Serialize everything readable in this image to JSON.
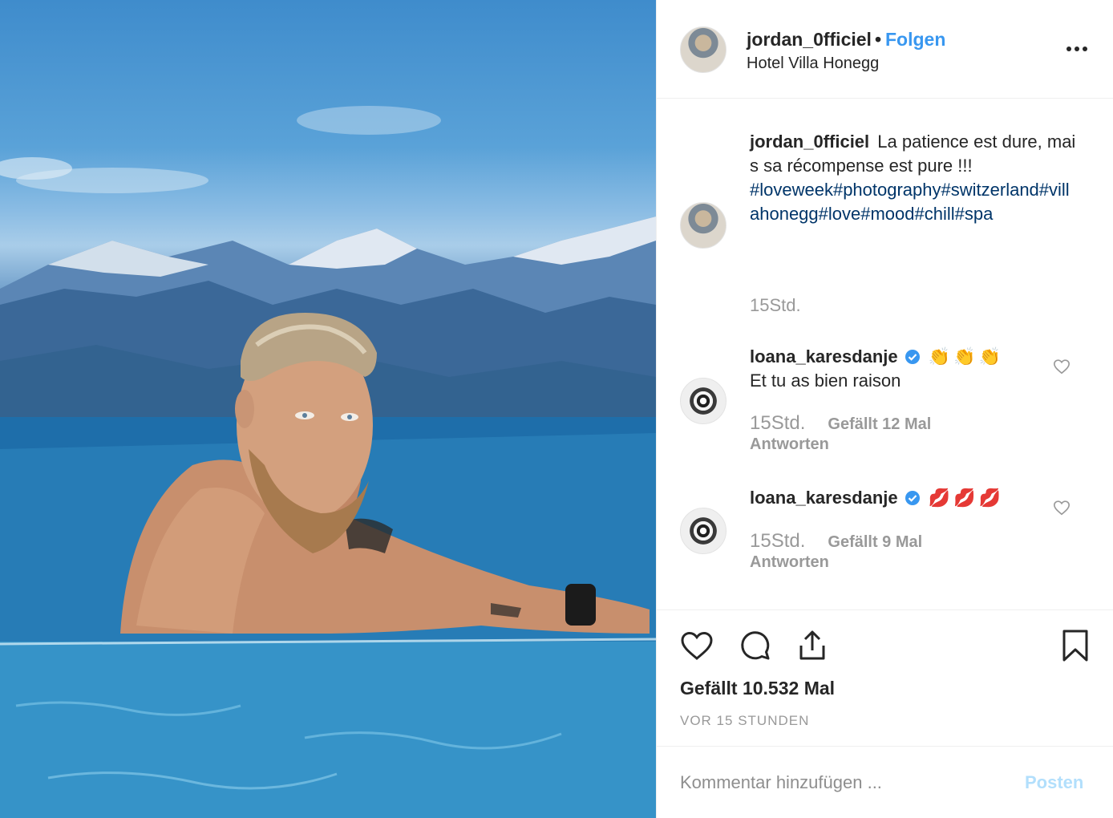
{
  "post": {
    "image": {
      "description_icon": "photo-image"
    },
    "owner": {
      "username": "jordan_0fficiel",
      "separator": "•",
      "follow_label": "Folgen",
      "location": "Hotel Villa Honegg",
      "more_icon": "more-options-icon"
    },
    "caption": {
      "username": "jordan_0fficiel",
      "text": "La patience est dure, mais sa récompense est pure !!!",
      "hashtags": "#loveweek#photography#switzerland#villahonegg#love#mood#chill#spa",
      "time": "15Std."
    },
    "comments": [
      {
        "username": "loana_karesdanje",
        "verified": true,
        "emoji": "👏👏👏",
        "text": "Et tu as bien raison",
        "time": "15Std.",
        "likes": "Gefällt 12 Mal",
        "reply": "Antworten"
      },
      {
        "username": "loana_karesdanje",
        "verified": true,
        "emoji": "💋💋💋",
        "text": "",
        "time": "15Std.",
        "likes": "Gefällt 9 Mal",
        "reply": "Antworten"
      }
    ],
    "likes_total": "Gefällt 10.532 Mal",
    "posted_ago": "VOR 15 STUNDEN",
    "comment_box": {
      "placeholder": "Kommentar hinzufügen ...",
      "post_label": "Posten"
    },
    "colors": {
      "link": "#3897f0",
      "hashtag": "#003569",
      "muted": "#999999",
      "post_disabled": "#b2dffc"
    }
  }
}
